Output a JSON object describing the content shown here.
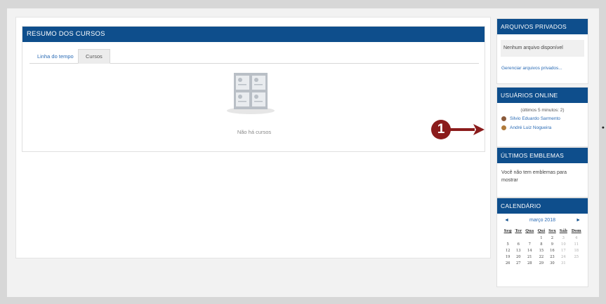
{
  "course_overview": {
    "title": "RESUMO DOS CURSOS",
    "tabs": [
      "Linha do tempo",
      "Cursos"
    ],
    "active_tab": "Cursos",
    "empty_message": "Não há cursos"
  },
  "private_files": {
    "title": "ARQUIVOS PRIVADOS",
    "empty_message": "Nenhum arquivo disponível",
    "manage_link": "Gerenciar arquivos privados..."
  },
  "online_users": {
    "title": "USUÁRIOS ONLINE",
    "subtitle": "(últimos 5 minutos: 2)",
    "users": [
      "Silvio Eduardo Sarmento",
      "André Luiz Nogueira"
    ]
  },
  "badges": {
    "title": "ÚLTIMOS EMBLEMAS",
    "message": "Você não tem emblemas para mostrar"
  },
  "calendar": {
    "title": "CALENDÁRIO",
    "month": "março 2018",
    "prev": "◄",
    "next": "►",
    "weekdays": [
      "Seg",
      "Ter",
      "Qua",
      "Qui",
      "Sex",
      "Sáb",
      "Dom"
    ],
    "weeks": [
      [
        "",
        "",
        "",
        "1",
        "2",
        "3",
        "4"
      ],
      [
        "5",
        "6",
        "7",
        "8",
        "9",
        "10",
        "11"
      ],
      [
        "12",
        "13",
        "14",
        "15",
        "16",
        "17",
        "18"
      ],
      [
        "19",
        "20",
        "21",
        "22",
        "23",
        "24",
        "25"
      ],
      [
        "26",
        "27",
        "28",
        "29",
        "30",
        "31",
        ""
      ]
    ]
  },
  "annotation": {
    "number": "1"
  },
  "colors": {
    "header_blue": "#0e4e8c",
    "link_blue": "#2a6bb5",
    "annotation_red": "#8b1c1c"
  }
}
